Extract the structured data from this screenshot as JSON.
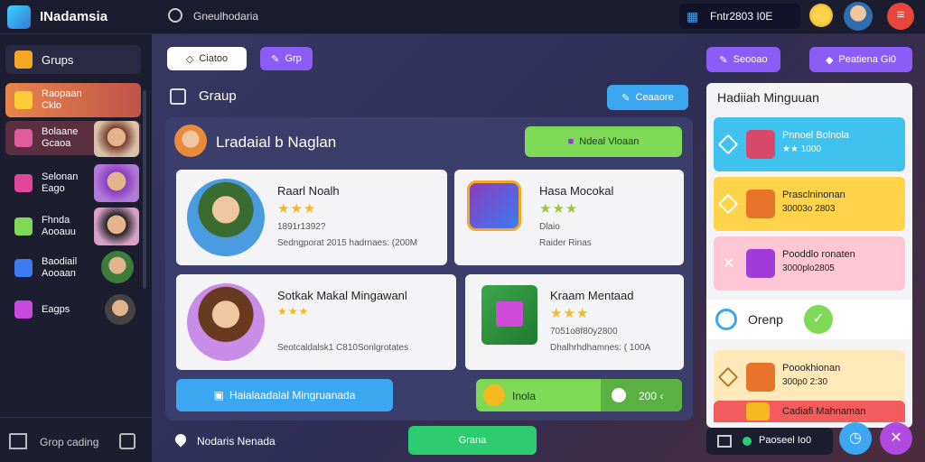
{
  "app": {
    "title": "INadamsia"
  },
  "topbar": {
    "location": "Gneulhodaria",
    "score": "Fntr2803 I0E"
  },
  "sidebar": {
    "items": [
      {
        "label": "Grups",
        "sub": ""
      },
      {
        "label": "Raopaan",
        "sub": "Cklo"
      },
      {
        "label": "Bolaane",
        "sub": "Gcaoa"
      },
      {
        "label": "Selonan",
        "sub": "Eago"
      },
      {
        "label": "Fhnda",
        "sub": "Aooauu"
      },
      {
        "label": "Baodiail",
        "sub": "Aooaan"
      },
      {
        "label": "Eagps",
        "sub": ""
      }
    ],
    "footer_label": "Grop cading"
  },
  "main": {
    "chip_left": "Ciatoo",
    "chip_right": "Grp",
    "section_title": "Graup",
    "create_button": "Ceaaore",
    "panel_title": "Lradaial b Naglan",
    "panel_button": "Ndeal Vloaan",
    "cards": [
      {
        "name": "Raarl Noalh",
        "stars": "★★★",
        "line1": "1891r1392?",
        "line2": "Sedngporat 2015 hadrnaes: (200M"
      },
      {
        "name": "Hasa Mocokal",
        "stars": "★★★",
        "line1": "Dlaio",
        "line2": "Raider Rinas"
      },
      {
        "name": "Sotkak Makal Mingawanl",
        "stars": "★★★",
        "line1": "",
        "line2": "Seotcaldalsk1 C810Sonlgrotates"
      },
      {
        "name": "Kraam Mentaad",
        "stars": "★★★",
        "line1": "7051o8f80y2800",
        "line2": "Dhalhrhdhamnes: ( 100A"
      }
    ],
    "bottom_left_button": "Haialaadalal Mingruanada",
    "bottom_right_label": "Inola",
    "bottom_right_value": "200 ‹",
    "footer_label": "Nodaris Nenada",
    "footer_button": "Grana"
  },
  "right": {
    "chip_left": "Seooao",
    "chip_right": "Peatiena  Gi0",
    "panel_title": "Hadiiah Minguuan",
    "rewards": [
      {
        "title": "Pnnoel Bolnola",
        "sub": "★★ 1000",
        "color": "#3fc3ee"
      },
      {
        "title": "Prasclninonan",
        "sub": "30003o 2803",
        "color": "#ffd34a"
      },
      {
        "title": "Pooddlo ronaten",
        "sub": "3000plo2805",
        "color": "#ffc7d6"
      }
    ],
    "group_label": "Orenp",
    "reward4_title": "Poookhionan",
    "reward4_sub": "300p0 2:30",
    "reward5_title": "Cadiafi Mahnaman",
    "footer_label": "Paoseel Io0"
  },
  "colors": {
    "accent_purple": "#8b5cf6",
    "accent_green": "#7ed957",
    "accent_blue": "#3aa7f0"
  }
}
